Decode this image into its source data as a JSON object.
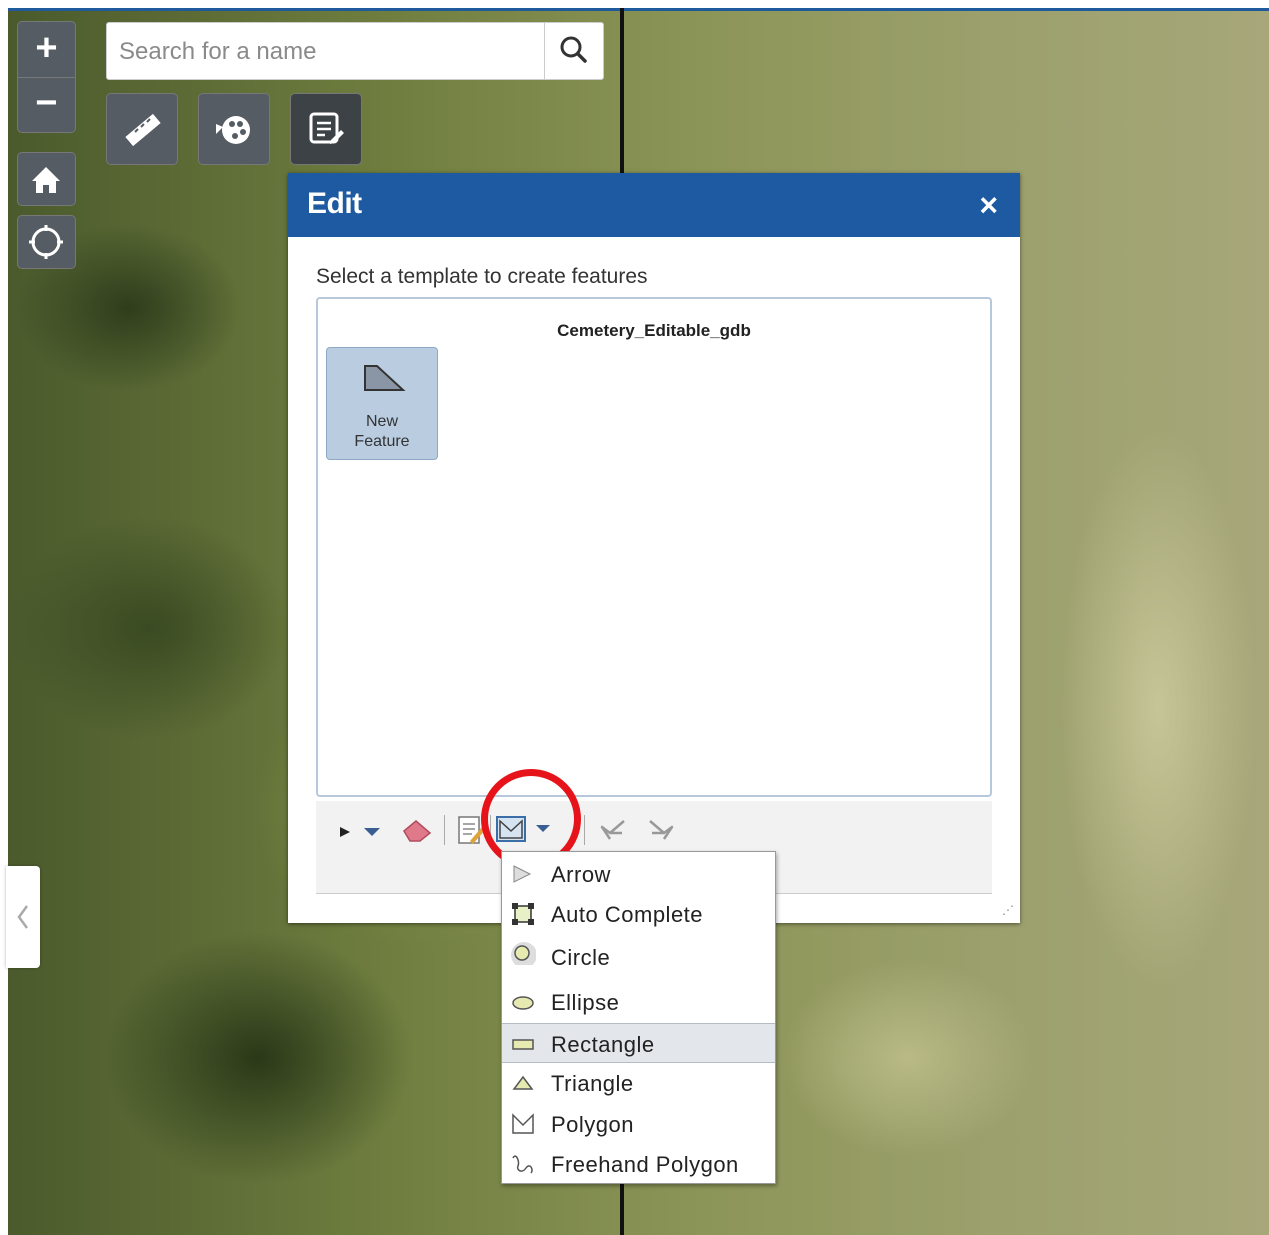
{
  "search": {
    "placeholder": "Search for a name"
  },
  "zoom": {
    "in_label": "+",
    "out_label": "−"
  },
  "panel": {
    "title": "Edit",
    "close_label": "×",
    "instruction": "Select a template to create features",
    "layer_name": "Cemetery_Editable_gdb",
    "template": {
      "label_line1": "New",
      "label_line2": "Feature"
    }
  },
  "draw_menu": {
    "items": [
      {
        "label": "Arrow",
        "icon": "arrow-icon"
      },
      {
        "label": "Auto Complete",
        "icon": "auto-complete-icon"
      },
      {
        "label": "Circle",
        "icon": "circle-icon"
      },
      {
        "label": "Ellipse",
        "icon": "ellipse-icon"
      },
      {
        "label": "Rectangle",
        "icon": "rectangle-icon",
        "selected": true
      },
      {
        "label": "Triangle",
        "icon": "triangle-icon"
      },
      {
        "label": "Polygon",
        "icon": "polygon-icon"
      },
      {
        "label": "Freehand Polygon",
        "icon": "freehand-polygon-icon"
      }
    ]
  },
  "colors": {
    "header_blue": "#1d5aa1",
    "highlight_ring": "#e6141a",
    "template_bg": "#b9cce0",
    "control_gray": "#555c63"
  }
}
